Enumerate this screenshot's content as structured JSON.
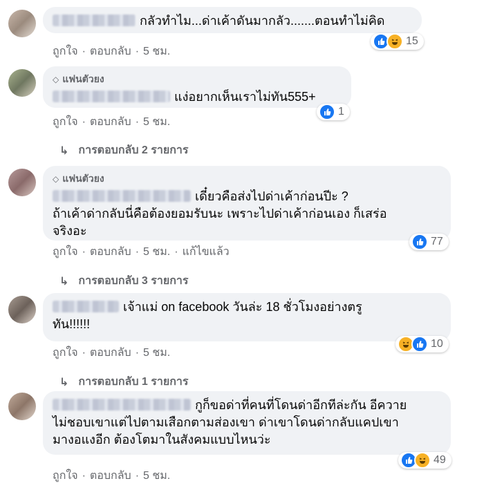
{
  "labels": {
    "like": "ถูกใจ",
    "reply": "ตอบกลับ",
    "dot": "·",
    "edited": "แก้ไขแล้ว",
    "fan_badge": "แฟนตัวยง"
  },
  "comments": [
    {
      "text": "กลัวทำไม...ด่าเค้าดันมากลัว.......ตอนทำไม่คิด",
      "time": "5 ชม.",
      "reaction_count": "15",
      "reactions": [
        "like-icon",
        "haha-icon"
      ]
    },
    {
      "text": "แง่อยากเห็นเราไม่ทัน555+",
      "time": "5 ชม.",
      "reaction_count": "1",
      "reactions": [
        "like-icon"
      ],
      "replies": "การตอบกลับ 2 รายการ"
    },
    {
      "text_lines": [
        "เดี๋ยวคือส่งไปด่าเค้าก่อนปีะ ?",
        "ถ้าเค้าด่ากลับนี่คือต้องยอมรับนะ เพราะไปด่าเค้าก่อนเอง ก็เสร่อ",
        "จริงอะ"
      ],
      "time": "5 ชม.",
      "reaction_count": "77",
      "reactions": [
        "like-icon"
      ],
      "replies": "การตอบกลับ 3 รายการ"
    },
    {
      "text_lines": [
        "เจ้าแม่ on facebook วันล่ะ 18 ชั่วโมงอย่างตรู",
        "ทัน!!!!!!"
      ],
      "time": "5 ชม.",
      "reaction_count": "10",
      "reactions": [
        "haha-icon",
        "like-icon"
      ],
      "replies": "การตอบกลับ 1 รายการ"
    },
    {
      "text_lines": [
        "กูก็ขอด่าที่คนที่โดนด่าอีกทีล่ะกัน อีควาย",
        "ไม่ชอบเขาแต่ไปตามเสือกตามส่องเขา ด่าเขาโดนด่ากลับแคปเขา",
        "มางอแงอีก ต้องโตมาในสังคมแบบไหนว่ะ"
      ],
      "time": "5 ชม.",
      "reaction_count": "49",
      "reactions": [
        "like-icon",
        "haha-icon"
      ]
    }
  ],
  "colors": {
    "bubble": "#f0f2f5",
    "meta": "#65676b",
    "like": "#1877f2",
    "haha": "#f7b125"
  }
}
